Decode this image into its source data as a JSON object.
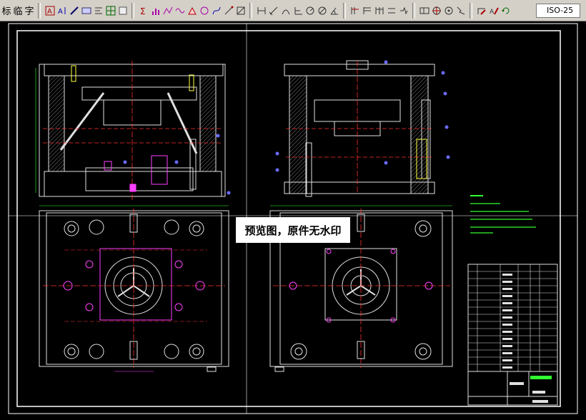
{
  "toolbar": {
    "chars": [
      "标",
      "临",
      "字"
    ],
    "dimstyle_value": "ISO-25",
    "icons": [
      "text-style-icon",
      "text-height-icon",
      "pen-icon",
      "text-edit-icon",
      "align-icon",
      "grid-icon",
      "box-icon",
      "sigma-icon",
      "chart-icon",
      "polyline-icon",
      "wave-icon",
      "area-icon",
      "circle-icon",
      "spline-icon",
      "measure-icon",
      "leader-icon",
      "dim-linear-icon",
      "dim-aligned-icon",
      "dim-arc-icon",
      "dim-ordinate-icon",
      "dim-radius-icon",
      "dim-diameter-icon",
      "dim-angular-icon",
      "dim-quick-icon",
      "dim-baseline-icon",
      "dim-continue-icon",
      "dim-space-icon",
      "dim-break-icon",
      "tolerance-icon",
      "center-mark-icon",
      "inspect-icon",
      "jogged-icon",
      "dim-edit-icon",
      "dim-text-edit-icon",
      "dim-update-icon"
    ]
  },
  "drawing": {
    "watermark": "预览图，原件无水印",
    "colors": {
      "background": "#000000",
      "frame": "#ffffff",
      "lines": "#e8e8e8",
      "red": "#ff3030",
      "green": "#30ff30",
      "magenta": "#ff40ff",
      "blue": "#6a6aff",
      "yellow": "#ffff40",
      "cyan": "#40ffff"
    }
  }
}
